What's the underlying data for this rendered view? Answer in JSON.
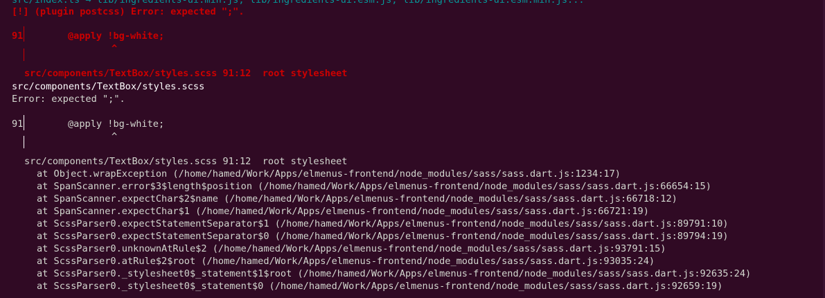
{
  "colors": {
    "background": "#300a24",
    "red": "#cc0000",
    "cyan": "#06989a",
    "white": "#ffffff",
    "grey": "#d3d7cf"
  },
  "lines": {
    "top_cut": "src/index.ts → lib/ingredients-ui.min.js, lib/ingredients-ui.esm.js, lib/ingredients-ui.esm.min.js...",
    "plugin_error": "[!] (plugin postcss) Error: expected \";\".",
    "frame1_lineno": "91",
    "frame1_code": "@apply !bg-white;",
    "frame1_caret": "^",
    "frame1_location": "src/components/TextBox/styles.scss 91:12  root stylesheet",
    "file_path": "src/components/TextBox/styles.scss",
    "error_msg": "Error: expected \";\".",
    "frame2_lineno": "91",
    "frame2_code": "@apply !bg-white;",
    "frame2_caret": "^",
    "frame2_location": "src/components/TextBox/styles.scss 91:12  root stylesheet"
  },
  "stack": [
    "at Object.wrapException (/home/hamed/Work/Apps/elmenus-frontend/node_modules/sass/sass.dart.js:1234:17)",
    "at SpanScanner.error$3$length$position (/home/hamed/Work/Apps/elmenus-frontend/node_modules/sass/sass.dart.js:66654:15)",
    "at SpanScanner.expectChar$2$name (/home/hamed/Work/Apps/elmenus-frontend/node_modules/sass/sass.dart.js:66718:12)",
    "at SpanScanner.expectChar$1 (/home/hamed/Work/Apps/elmenus-frontend/node_modules/sass/sass.dart.js:66721:19)",
    "at ScssParser0.expectStatementSeparator$1 (/home/hamed/Work/Apps/elmenus-frontend/node_modules/sass/sass.dart.js:89791:10)",
    "at ScssParser0.expectStatementSeparator$0 (/home/hamed/Work/Apps/elmenus-frontend/node_modules/sass/sass.dart.js:89794:19)",
    "at ScssParser0.unknownAtRule$2 (/home/hamed/Work/Apps/elmenus-frontend/node_modules/sass/sass.dart.js:93791:15)",
    "at ScssParser0.atRule$2$root (/home/hamed/Work/Apps/elmenus-frontend/node_modules/sass/sass.dart.js:93035:24)",
    "at ScssParser0._stylesheet0$_statement$1$root (/home/hamed/Work/Apps/elmenus-frontend/node_modules/sass/sass.dart.js:92635:24)",
    "at ScssParser0._stylesheet0$_statement$0 (/home/hamed/Work/Apps/elmenus-frontend/node_modules/sass/sass.dart.js:92659:19)"
  ]
}
